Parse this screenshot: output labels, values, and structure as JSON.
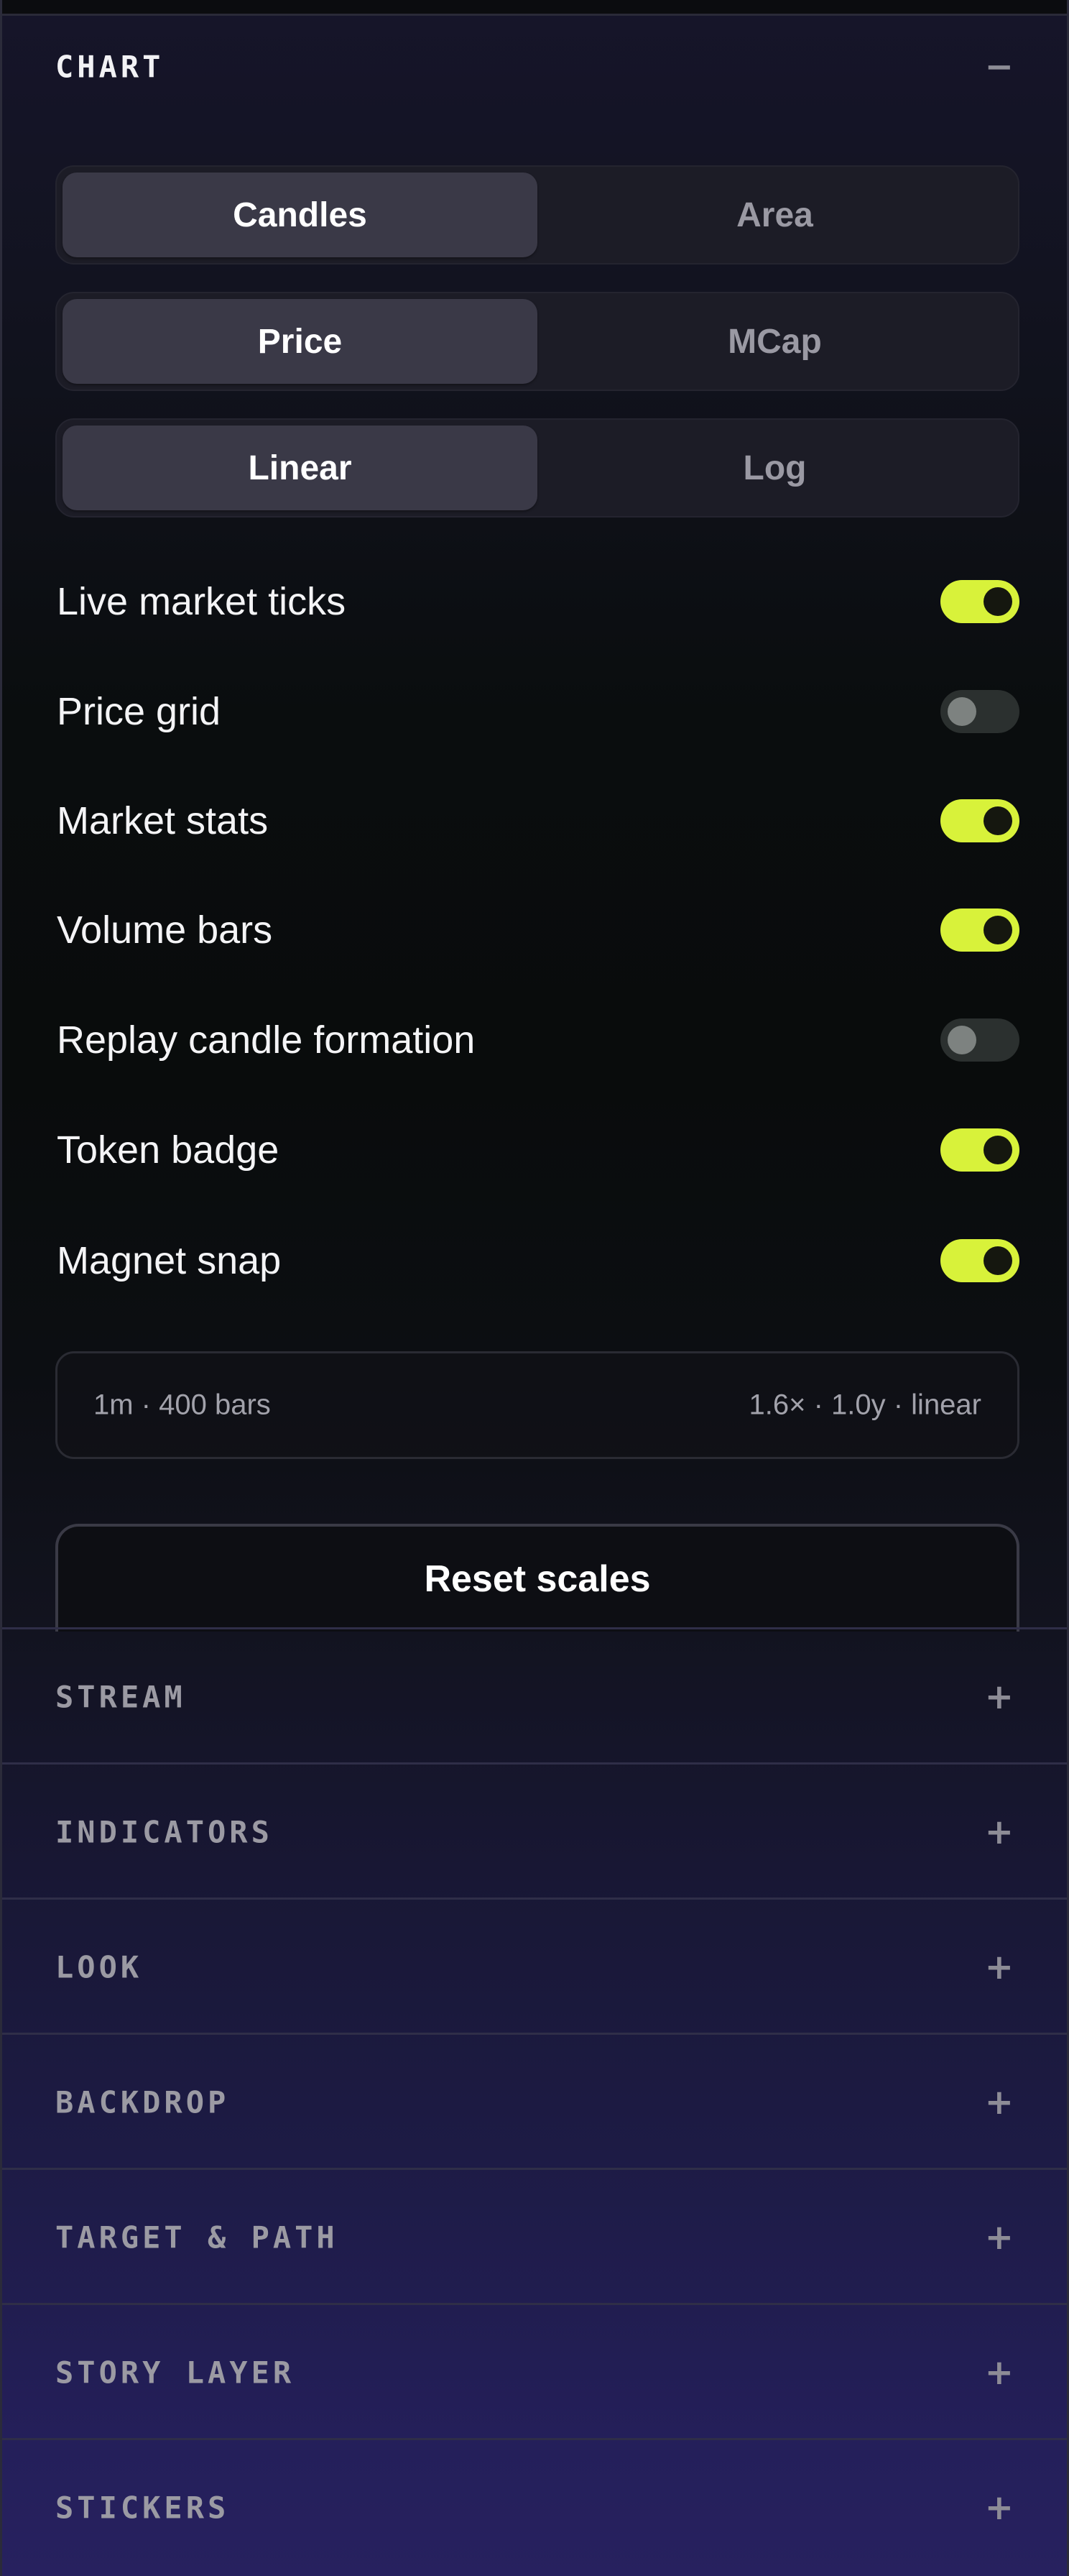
{
  "chart": {
    "title": "CHART",
    "collapse_icon": "minus-icon",
    "collapse_glyph": "−",
    "segments": [
      {
        "options": [
          "Candles",
          "Area"
        ],
        "active": 0
      },
      {
        "options": [
          "Price",
          "MCap"
        ],
        "active": 0
      },
      {
        "options": [
          "Linear",
          "Log"
        ],
        "active": 0
      }
    ],
    "toggles": [
      {
        "label": "Live market ticks",
        "on": true
      },
      {
        "label": "Price grid",
        "on": false
      },
      {
        "label": "Market stats",
        "on": true
      },
      {
        "label": "Volume bars",
        "on": true
      },
      {
        "label": "Replay candle formation",
        "on": false
      },
      {
        "label": "Token badge",
        "on": true
      },
      {
        "label": "Magnet snap",
        "on": true
      }
    ],
    "info_left": "1m · 400 bars",
    "info_right": "1.6× · 1.0y · linear",
    "reset_label": "Reset scales"
  },
  "sections": [
    {
      "title": "STREAM",
      "expand_glyph": "+"
    },
    {
      "title": "INDICATORS",
      "expand_glyph": "+"
    },
    {
      "title": "LOOK",
      "expand_glyph": "+"
    },
    {
      "title": "BACKDROP",
      "expand_glyph": "+"
    },
    {
      "title": "TARGET & PATH",
      "expand_glyph": "+"
    },
    {
      "title": "STORY LAYER",
      "expand_glyph": "+"
    },
    {
      "title": "STICKERS",
      "expand_glyph": "+"
    }
  ],
  "colors": {
    "accent": "#d8f23a",
    "switch_off": "#2b302f",
    "segment_active": "#3a3947"
  }
}
